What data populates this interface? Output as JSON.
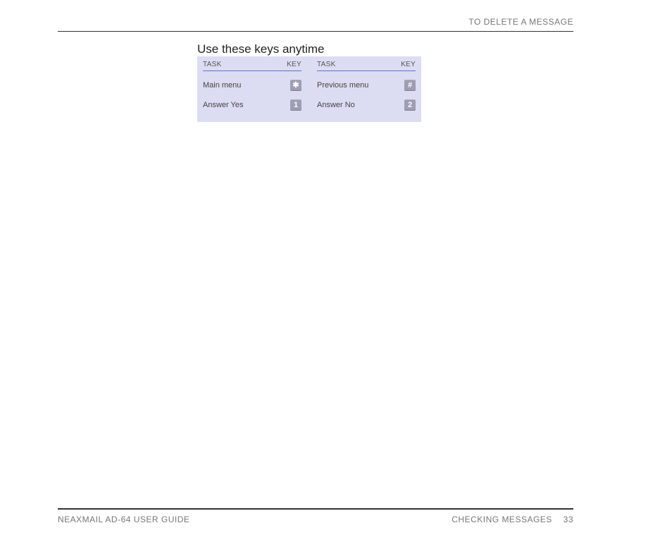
{
  "header": {
    "title": "TO DELETE A MESSAGE"
  },
  "section_heading": "Use these keys anytime",
  "key_table": {
    "col_task": "TASK",
    "col_key": "KEY",
    "left": {
      "row1_task": "Main menu",
      "row1_key": "✱",
      "row2_task": "Answer Yes",
      "row2_key": "1"
    },
    "right": {
      "row1_task": "Previous menu",
      "row1_key": "#",
      "row2_task": "Answer No",
      "row2_key": "2"
    }
  },
  "footer": {
    "guide": "NEAXMAIL AD-64 USER GUIDE",
    "section": "CHECKING MESSAGES",
    "page": "33"
  }
}
